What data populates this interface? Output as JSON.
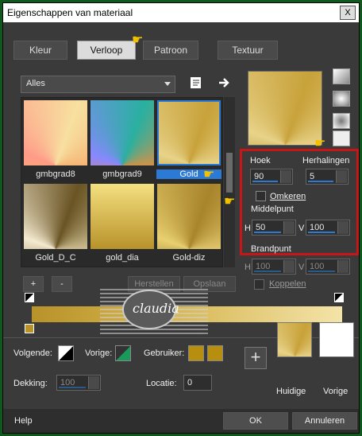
{
  "window": {
    "title": "Eigenschappen van materiaal",
    "close": "X"
  },
  "tabs": [
    {
      "label": "Kleur"
    },
    {
      "label": "Verloop"
    },
    {
      "label": "Patroon"
    },
    {
      "label": "Textuur"
    }
  ],
  "gallery": {
    "category": "Alles",
    "items": [
      {
        "name": "gmbgrad8"
      },
      {
        "name": "gmbgrad9"
      },
      {
        "name": "Gold"
      },
      {
        "name": "Gold_D_C"
      },
      {
        "name": "gold_dia"
      },
      {
        "name": "Gold-diz"
      }
    ]
  },
  "editor": {
    "add": "+",
    "remove": "-",
    "reset": "Herstellen",
    "save": "Opslaan"
  },
  "settings": {
    "angle_label": "Hoek",
    "angle": "90",
    "repeats_label": "Herhalingen",
    "repeats": "5",
    "invert_label": "Omkeren",
    "center_label": "Middelpunt",
    "center_h_label": "H",
    "center_h": "50",
    "center_v_label": "V",
    "center_v": "100",
    "focal_label": "Brandpunt",
    "focal_h_label": "H",
    "focal_h": "100",
    "focal_v_label": "V",
    "focal_v": "100",
    "link_label": "Koppelen"
  },
  "bottom": {
    "next_label": "Volgende:",
    "prev_label": "Vorige:",
    "user_label": "Gebruiker:",
    "opacity_label": "Dekking:",
    "opacity": "100",
    "location_label": "Locatie:",
    "location": "0",
    "current_label": "Huidige",
    "previous_label": "Vorige"
  },
  "footer": {
    "help": "Help",
    "ok": "OK",
    "cancel": "Annuleren"
  },
  "watermark": {
    "text": "claudia"
  },
  "colors": {
    "gold": "#b8922a",
    "accent": "#2a7ad6",
    "highlight": "#c81515",
    "pointer": "#f2c200"
  }
}
